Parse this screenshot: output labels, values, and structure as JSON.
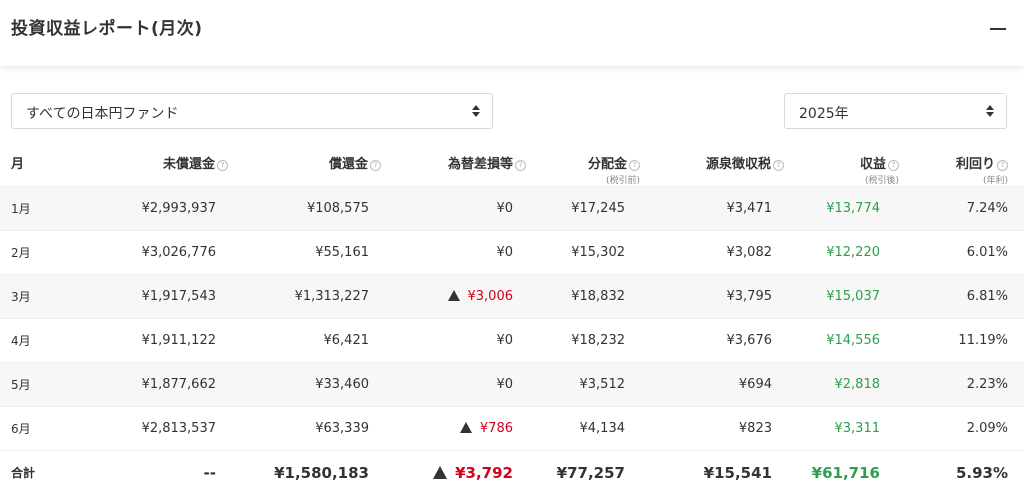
{
  "header": {
    "title": "投資収益レポート(月次)"
  },
  "filters": {
    "fund": "すべての日本円ファンド",
    "year": "2025年"
  },
  "columns": {
    "month": "月",
    "unredeemed": "未償還金",
    "redeemed": "償還金",
    "fx_loss": "為替差損等",
    "distribution": "分配金",
    "distribution_sub": "(税引前)",
    "withholding_tax": "源泉徴収税",
    "income": "収益",
    "income_sub": "(税引後)",
    "yield": "利回り",
    "yield_sub": "(年利)"
  },
  "rows": [
    {
      "month": "1月",
      "unredeemed": "¥2,993,937",
      "redeemed": "¥108,575",
      "fx_loss": "¥0",
      "fx_negative": false,
      "distribution": "¥17,245",
      "withholding_tax": "¥3,471",
      "income": "¥13,774",
      "yield": "7.24%"
    },
    {
      "month": "2月",
      "unredeemed": "¥3,026,776",
      "redeemed": "¥55,161",
      "fx_loss": "¥0",
      "fx_negative": false,
      "distribution": "¥15,302",
      "withholding_tax": "¥3,082",
      "income": "¥12,220",
      "yield": "6.01%"
    },
    {
      "month": "3月",
      "unredeemed": "¥1,917,543",
      "redeemed": "¥1,313,227",
      "fx_loss": "¥3,006",
      "fx_negative": true,
      "distribution": "¥18,832",
      "withholding_tax": "¥3,795",
      "income": "¥15,037",
      "yield": "6.81%"
    },
    {
      "month": "4月",
      "unredeemed": "¥1,911,122",
      "redeemed": "¥6,421",
      "fx_loss": "¥0",
      "fx_negative": false,
      "distribution": "¥18,232",
      "withholding_tax": "¥3,676",
      "income": "¥14,556",
      "yield": "11.19%"
    },
    {
      "month": "5月",
      "unredeemed": "¥1,877,662",
      "redeemed": "¥33,460",
      "fx_loss": "¥0",
      "fx_negative": false,
      "distribution": "¥3,512",
      "withholding_tax": "¥694",
      "income": "¥2,818",
      "yield": "2.23%"
    },
    {
      "month": "6月",
      "unredeemed": "¥2,813,537",
      "redeemed": "¥63,339",
      "fx_loss": "¥786",
      "fx_negative": true,
      "distribution": "¥4,134",
      "withholding_tax": "¥823",
      "income": "¥3,311",
      "yield": "2.09%"
    }
  ],
  "total": {
    "month": "合計",
    "unredeemed": "--",
    "redeemed": "¥1,580,183",
    "fx_loss": "¥3,792",
    "fx_negative": true,
    "distribution": "¥77,257",
    "withholding_tax": "¥15,541",
    "income": "¥61,716",
    "yield": "5.93%"
  },
  "colors": {
    "income": "#2e9e4f",
    "fx_negative": "#d0021b",
    "row_stripe": "#f7f7f7"
  },
  "icons": {
    "help": "question-circle-icon",
    "negative": "triangle-up-icon",
    "collapse": "minus-icon"
  }
}
